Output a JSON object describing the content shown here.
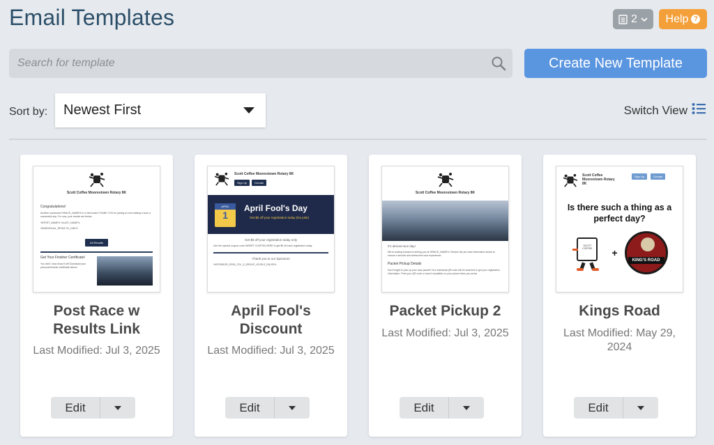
{
  "header": {
    "title": "Email Templates",
    "pages_count": "2",
    "help_label": "Help"
  },
  "search": {
    "placeholder": "Search for template"
  },
  "create_button": "Create New Template",
  "sort": {
    "label": "Sort by:",
    "selected": "Newest First"
  },
  "switch_view": "Switch View",
  "thumbs": {
    "brand": "Scott Coffee Moorestown Rotary 8K",
    "sign_up": "Sign Up",
    "donate": "Donate",
    "t1": {
      "congrats": "Congratulations!",
      "body": "Another successful %RACE_NAME% is in the books! THANK YOU for joining us and making it such a successful day. For now, your results are below:",
      "name_tokens": "%FIRST_NAME% %LAST_NAME%",
      "results_tokens": "%INDIVIDUAL_RESULTS_LINK%",
      "all_results": "All Results",
      "finisher_title": "Get Your Finisher Certificate!",
      "finisher_body": "You did it. Now show it off! Download your personal finisher certificate below!"
    },
    "t2": {
      "banner_title": "April Fool's Day",
      "banner_sub": "Get $5 off your registration today (No joke)",
      "cal_month": "APRIL",
      "cal_day": "1",
      "offer": "Get $5 off your registration today only",
      "code_text": "Use the special coupon code INSERT COUPON HERE to get $5 off each registration today.",
      "sponsors": "Thank you to our Sponsors",
      "sponsor_tokens": "%SPONSOR_GRID_COL_3_GROUP_LEVELS_FALSE%"
    },
    "t3": {
      "race_day": "It's almost race day!",
      "body": "We're looking forward to seeing you at %RACE_NAME%. Review the pre-race information below to ensure a smooth and stress-free race experience.",
      "packet_title": "Packet Pickup Details",
      "packet_body": "Don't forget to pick up your race packet! Your individual QR code will be scanned to get your registration information. Print your QR code or have it available on your phone when you arrive."
    },
    "t4": {
      "headline": "Is there such a thing as a perfect day?",
      "plus": "+",
      "badge": "KING'S ROAD",
      "mug_label": "SCOTT COFFEE"
    }
  },
  "cards": [
    {
      "title": "Post Race w Results Link",
      "modified": "Last Modified: Jul 3, 2025",
      "edit": "Edit"
    },
    {
      "title": "April Fool's Discount",
      "modified": "Last Modified: Jul 3, 2025",
      "edit": "Edit"
    },
    {
      "title": "Packet Pickup 2",
      "modified": "Last Modified: Jul 3, 2025",
      "edit": "Edit"
    },
    {
      "title": "Kings Road",
      "modified": "Last Modified: May 29, 2024",
      "edit": "Edit"
    }
  ],
  "colors": {
    "title": "#2c4e68",
    "create_button": "#5a95e0",
    "help_button": "#f4a03a",
    "background": "#e6eaef"
  }
}
